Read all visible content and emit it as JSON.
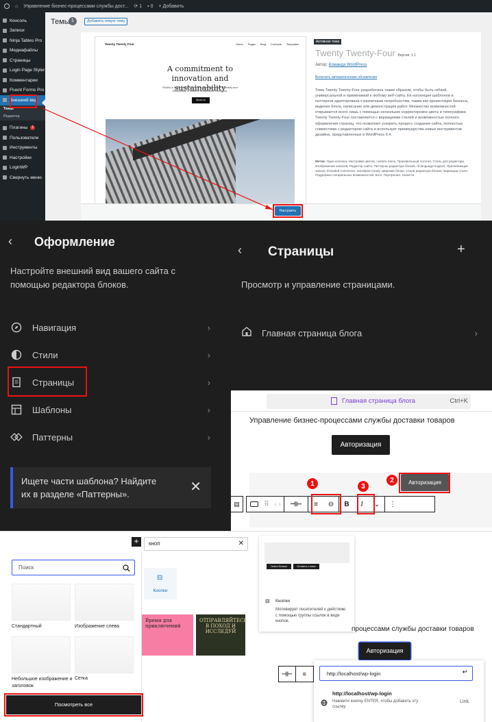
{
  "wp_admin": {
    "adminbar": {
      "site_name": "Управление бизнес-процессами службы дост...",
      "updates": "1",
      "comments": "0",
      "new_label": "+ Добавить"
    },
    "sidebar": [
      {
        "label": "Консоль",
        "icon": "dashboard-icon"
      },
      {
        "label": "Записи",
        "icon": "pin-icon"
      },
      {
        "label": "Ninja Tables Pro",
        "icon": "table-icon"
      },
      {
        "label": "Медиафайлы",
        "icon": "media-icon"
      },
      {
        "label": "Страницы",
        "icon": "page-icon"
      },
      {
        "label": "Login Page Styler",
        "icon": "gear-icon"
      },
      {
        "label": "Комментарии",
        "icon": "comment-icon"
      },
      {
        "label": "Fluent Forms Pro",
        "icon": "form-icon"
      },
      {
        "label": "Внешний вид",
        "icon": "brush-icon",
        "active": true
      }
    ],
    "submenu": [
      "Темы",
      "Редактор"
    ],
    "sidebar_after": [
      {
        "label": "Плагины",
        "icon": "plugin-icon",
        "badge": "1"
      },
      {
        "label": "Пользователи",
        "icon": "user-icon"
      },
      {
        "label": "Инструменты",
        "icon": "wrench-icon"
      },
      {
        "label": "Настройки",
        "icon": "settings-icon"
      },
      {
        "label": "LoginWP",
        "icon": "home-icon"
      },
      {
        "label": "Свернуть меню",
        "icon": "collapse-icon"
      }
    ],
    "page_title": "Темы",
    "theme_count": "1",
    "add_new_label": "Добавить новую тему",
    "theme_preview": {
      "brand": "Twenty Twenty Four",
      "nav": [
        "Home",
        "Pages",
        "Blog",
        "Contacts",
        "Templates"
      ],
      "headline": "A commitment to innovation and sustainability",
      "body": "Études is a pioneering firm that seamlessly merges creativity and functionality to redefine architectural excellence.",
      "cta": "About us"
    },
    "active_label": "Активная тема",
    "theme_name": "Twenty Twenty-Four",
    "version": "Версия: 1.1",
    "author_prefix": "Автор:",
    "author": "Команда WordPress",
    "auto_updates": "Включить автоматические обновления",
    "description": "Тема Twenty Twenty-Four разработана таким образом, чтобы быть гибкой, универсальной и применимой к любому веб-сайту. Её коллекция шаблонов и паттернов адаптирована к различным потребностям, таким как презентация бизнеса, ведение блога, написание или демонстрация работ. Множество возможностей открывается всего лишь с помощью нескольких корректировок цвета и типографики. Twenty Twenty-Four поставляется с вариациями стилей и возможностью полного оформления страниц, что позволяет ускорить процесс создания сайта, полностью совместима с редактором сайта и использует преимущества новых инструментов дизайна, представленных в WordPress 6.4.",
    "tags_label": "Метки:",
    "tags": "Одна колонка, Настройки цветов, custom-menu, Произвольный логотип, Стиль для редактора, Изображения записей, Редактор сайта, Паттерны редактора блоков, rtl-language-support, Прилипающие записи, threaded-comments, translation-ready, Широкие блоки, Стили редактора блоков, Вариации стиля, Поддержка специальных возможностей, Блог, Портфолио, Новости",
    "customize_label": "Настроить"
  },
  "design_panel": {
    "back_icon": "chevron-left-icon",
    "title": "Оформление",
    "description": "Настройте внешний вид вашего сайта с помощью редактора блоков.",
    "items": [
      {
        "label": "Навигация",
        "icon": "compass-icon"
      },
      {
        "label": "Стили",
        "icon": "half-circle-icon"
      },
      {
        "label": "Страницы",
        "icon": "page-icon"
      },
      {
        "label": "Шаблоны",
        "icon": "layout-icon"
      },
      {
        "label": "Паттерны",
        "icon": "symbol-icon"
      }
    ],
    "notice": "Ищете части шаблона? Найдите их в разделе «Паттерны»."
  },
  "pages_panel": {
    "title": "Страницы",
    "description": "Просмотр и управление страницами.",
    "item": "Главная страница блога"
  },
  "editor": {
    "command_bar_title": "Главная страница блога",
    "shortcut": "Ctrl+K",
    "site_title": "Управление бизнес-процессами службы доставки товаров",
    "button_label": "Авторизация",
    "button_label_selected": "Авторизация",
    "steps": [
      "1",
      "2",
      "3"
    ],
    "toolbar_bold": "B",
    "toolbar_italic": "I"
  },
  "inserter": {
    "search_query": "кноп",
    "block_label": "Кнопки",
    "patterns_search_placeholder": "Поиск",
    "patterns": [
      "Стандартный",
      "Изображение слева",
      "Небольшое изображение и заголовок",
      "Сетка"
    ],
    "view_all_label": "Посмотреть все",
    "card1_title": "Время для приключений",
    "card2_title": "ОТПРАВЛЯЙТЕСЬ В ПОХОД И ИССЛЕДУЙ"
  },
  "preview": {
    "btn1": "Узнать больше",
    "btn2": "Оставить с нами",
    "block_name": "Кнопки",
    "block_desc": "Мотивирует посетителей к действию с помощью группы ссылок в виде кнопок.",
    "site_title_partial": "процессами службы доставки товаров",
    "button_label": "Авторизация",
    "link_input": "http://localhost/wp-login",
    "suggestion_title": "http://localhost/wp-login",
    "suggestion_desc": "Нажмите кнопку ENTER, чтобы добавить эту ссылку",
    "suggestion_type": "Link"
  }
}
